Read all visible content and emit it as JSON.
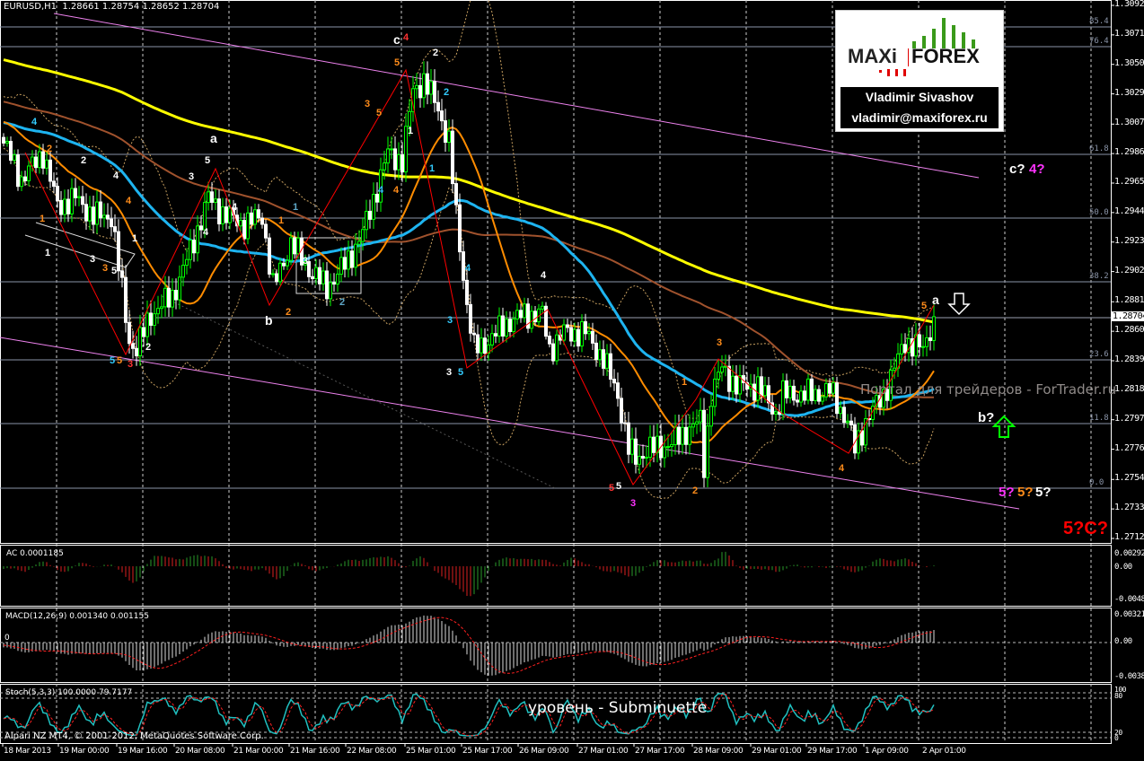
{
  "header": {
    "symbol": "EURUSD,H1",
    "open": "1.28661",
    "high": "1.28754",
    "low": "1.28652",
    "close": "1.28704"
  },
  "price_axis": [
    "1.30920",
    "1.30710",
    "1.30500",
    "1.30290",
    "1.30075",
    "1.29865",
    "1.29655",
    "1.29445",
    "1.29235",
    "1.29025",
    "1.28810",
    "1.28600",
    "1.28390",
    "1.28180",
    "1.27970",
    "1.27760",
    "1.27545",
    "1.27335",
    "1.27125"
  ],
  "current_price": "1.28704",
  "fib_levels": [
    "85.4",
    "76.4",
    "61.8",
    "50.0",
    "38.2",
    "23.6",
    "11.8",
    "0.0"
  ],
  "time_axis": [
    "18 Mar 2013",
    "19 Mar 00:00",
    "19 Mar 16:00",
    "20 Mar 08:00",
    "21 Mar 00:00",
    "21 Mar 16:00",
    "22 Mar 08:00",
    "25 Mar 01:00",
    "25 Mar 17:00",
    "26 Mar 09:00",
    "27 Mar 01:00",
    "27 Mar 17:00",
    "28 Mar 09:00",
    "29 Mar 01:00",
    "29 Mar 17:00",
    "1 Apr 09:00",
    "2 Apr 01:00"
  ],
  "logo": {
    "brand_left": "MAXi",
    "brand_right": "FOREX",
    "author": "Vladimir Sivashov",
    "email": "vladimir@maxiforex.ru"
  },
  "watermark": "Портал для трейдеров - ForTrader.ru",
  "level_caption": "уровень - Subminuette",
  "copyright": "Alpari NZ MT4, © 2001-2012, MetaQuotes Software Corp.",
  "indicators": {
    "ac": {
      "label": "AC 0.0001185",
      "axis": [
        "0.002920",
        "0.00",
        "-0.004833"
      ]
    },
    "macd": {
      "label": "MACD(12,26,9) 0.001340 0.001155",
      "axis": [
        "0.003217",
        "0.00",
        "-0.003847"
      ],
      "zero": "0"
    },
    "stoch": {
      "label": "Stoch(5,3,3) 100.0000 79.7177",
      "axis": [
        "100",
        "80",
        "20",
        "0"
      ]
    }
  },
  "wave_labels": [
    {
      "text": "4",
      "color": "#33ccff"
    },
    {
      "text": "2",
      "color": "#ff8c1a"
    },
    {
      "text": "2",
      "color": "#ffffff"
    },
    {
      "text": "4",
      "color": "#ffffff"
    },
    {
      "text": "4",
      "color": "#ff8c1a"
    },
    {
      "text": "1",
      "color": "#ff8c1a"
    },
    {
      "text": "1",
      "color": "#ffffff"
    },
    {
      "text": "1",
      "color": "#ffffff"
    },
    {
      "text": "3",
      "color": "#ffffff"
    },
    {
      "text": "3",
      "color": "#ff8c1a"
    },
    {
      "text": "5",
      "color": "#ffffff"
    },
    {
      "text": "5",
      "color": "#33ccff"
    },
    {
      "text": "5",
      "color": "#ff8c1a"
    },
    {
      "text": "3",
      "color": "#ff3333"
    },
    {
      "text": "2",
      "color": "#ffffff"
    },
    {
      "text": "a",
      "color": "#ffffff"
    },
    {
      "text": "5",
      "color": "#ffffff"
    },
    {
      "text": "3",
      "color": "#ffffff"
    },
    {
      "text": "4",
      "color": "#ffffff"
    },
    {
      "text": "4",
      "color": "#ffffff"
    },
    {
      "text": "1",
      "color": "#ff8c1a"
    },
    {
      "text": "1",
      "color": "#5fa8c8"
    },
    {
      "text": "3",
      "color": "#ffffff"
    },
    {
      "text": "2",
      "color": "#5fa8c8"
    },
    {
      "text": "b",
      "color": "#ffffff"
    },
    {
      "text": "2",
      "color": "#ff8c1a"
    },
    {
      "text": "c",
      "color": "#ffffff"
    },
    {
      "text": "4",
      "color": "#ff3333"
    },
    {
      "text": "5",
      "color": "#ff8c1a"
    },
    {
      "text": "2",
      "color": "#ffffff"
    },
    {
      "text": "2",
      "color": "#33ccff"
    },
    {
      "text": "3",
      "color": "#ff8c1a"
    },
    {
      "text": "5",
      "color": "#ff8c1a"
    },
    {
      "text": "1",
      "color": "#ffffff"
    },
    {
      "text": "1",
      "color": "#33ccff"
    },
    {
      "text": "4",
      "color": "#33ccff"
    },
    {
      "text": "4",
      "color": "#ff8c1a"
    },
    {
      "text": "4",
      "color": "#33ccff"
    },
    {
      "text": "3",
      "color": "#33ccff"
    },
    {
      "text": "3",
      "color": "#ffffff"
    },
    {
      "text": "5",
      "color": "#33ccff"
    },
    {
      "text": "4",
      "color": "#ffffff"
    },
    {
      "text": "5",
      "color": "#ff3333"
    },
    {
      "text": "5",
      "color": "#ffffff"
    },
    {
      "text": "3",
      "color": "#ff33ff"
    },
    {
      "text": "2",
      "color": "#ff8c1a"
    },
    {
      "text": "1",
      "color": "#ff8c1a"
    },
    {
      "text": "3",
      "color": "#ff8c1a"
    },
    {
      "text": "4",
      "color": "#ff8c1a"
    },
    {
      "text": "a",
      "color": "#ffffff"
    },
    {
      "text": "5",
      "color": "#ff8c1a"
    },
    {
      "text": "c?",
      "color": "#ffffff"
    },
    {
      "text": "4?",
      "color": "#ff33ff"
    },
    {
      "text": "b?",
      "color": "#ffffff"
    },
    {
      "text": "5?",
      "color": "#ff33ff"
    },
    {
      "text": "5?",
      "color": "#ff8c1a"
    },
    {
      "text": "5?",
      "color": "#ffffff"
    },
    {
      "text": "5?C?",
      "color": "#ff0000"
    }
  ],
  "colors": {
    "bull": "#00ff00",
    "bear": "#ffffff",
    "ma_long": "#ffff00",
    "ma_mid": "#a0522d",
    "ma_fast": "#1eb4f0",
    "ma_short": "#ff8c00",
    "channel": "#ee82ee",
    "zigzag": "#ff0000",
    "fib": "#8a94a8"
  },
  "chart_data": {
    "type": "candlestick",
    "title": "EURUSD,H1",
    "bars": 260,
    "ylim": [
      1.27125,
      1.3092
    ],
    "keypoints": [
      [
        0,
        1.2994
      ],
      [
        5,
        1.2968
      ],
      [
        11,
        1.2987
      ],
      [
        15,
        1.2949
      ],
      [
        20,
        1.2955
      ],
      [
        25,
        1.2942
      ],
      [
        30,
        1.2942
      ],
      [
        35,
        1.2853
      ],
      [
        37,
        1.2847
      ],
      [
        41,
        1.2872
      ],
      [
        47,
        1.2885
      ],
      [
        52,
        1.2917
      ],
      [
        57,
        1.2955
      ],
      [
        62,
        1.2942
      ],
      [
        67,
        1.2936
      ],
      [
        72,
        1.2942
      ],
      [
        75,
        1.2891
      ],
      [
        80,
        1.2923
      ],
      [
        85,
        1.2904
      ],
      [
        90,
        1.2891
      ],
      [
        96,
        1.2911
      ],
      [
        100,
        1.293
      ],
      [
        104,
        1.2962
      ],
      [
        107,
        1.2987
      ],
      [
        111,
        1.2981
      ],
      [
        114,
        1.3032
      ],
      [
        117,
        1.3038
      ],
      [
        121,
        1.3019
      ],
      [
        124,
        1.2994
      ],
      [
        126,
        1.2942
      ],
      [
        129,
        1.2879
      ],
      [
        131,
        1.2847
      ],
      [
        135,
        1.2853
      ],
      [
        140,
        1.2866
      ],
      [
        145,
        1.2872
      ],
      [
        150,
        1.2872
      ],
      [
        152,
        1.2847
      ],
      [
        156,
        1.2859
      ],
      [
        162,
        1.2859
      ],
      [
        167,
        1.284
      ],
      [
        171,
        1.2815
      ],
      [
        174,
        1.2776
      ],
      [
        176,
        1.277
      ],
      [
        180,
        1.2776
      ],
      [
        186,
        1.278
      ],
      [
        190,
        1.2789
      ],
      [
        194,
        1.2796
      ],
      [
        195,
        1.2764
      ],
      [
        197,
        1.2815
      ],
      [
        200,
        1.2834
      ],
      [
        204,
        1.2821
      ],
      [
        210,
        1.2821
      ],
      [
        215,
        1.2802
      ],
      [
        217,
        1.2815
      ],
      [
        225,
        1.2815
      ],
      [
        230,
        1.2818
      ],
      [
        235,
        1.2796
      ],
      [
        237,
        1.2776
      ],
      [
        240,
        1.2796
      ],
      [
        245,
        1.2815
      ],
      [
        249,
        1.284
      ],
      [
        251,
        1.2853
      ],
      [
        256,
        1.2847
      ],
      [
        259,
        1.28704
      ]
    ]
  }
}
